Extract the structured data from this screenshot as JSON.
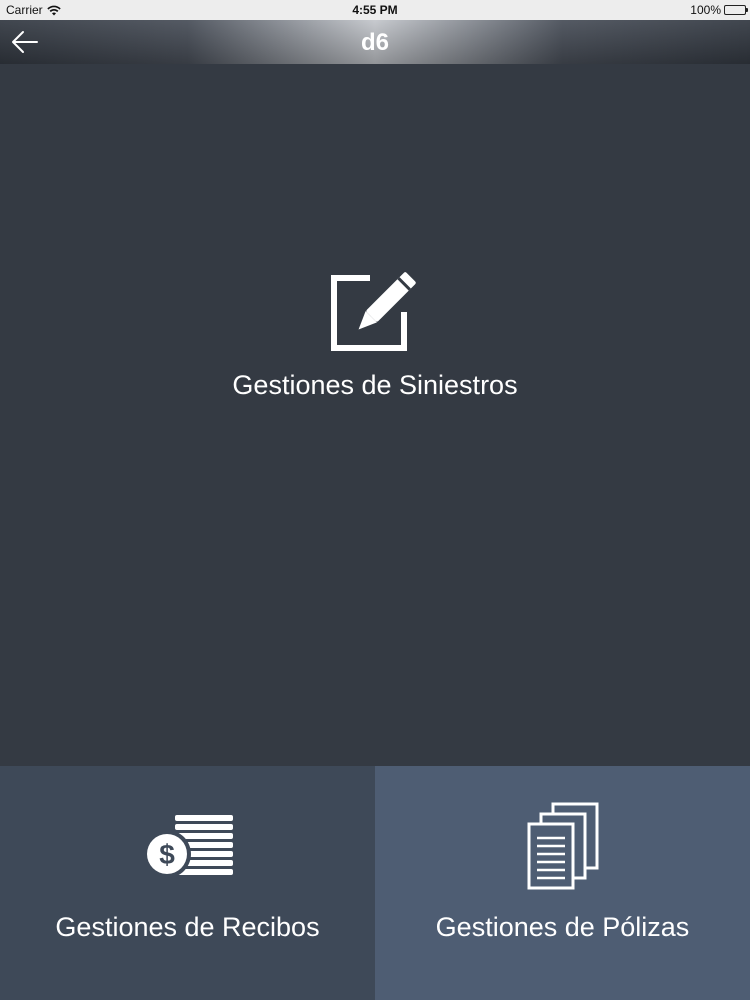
{
  "status_bar": {
    "carrier": "Carrier",
    "time": "4:55 PM",
    "battery": "100%"
  },
  "nav": {
    "back_icon": "arrow-left-icon",
    "logo_text": "d6"
  },
  "menu": {
    "siniestros": {
      "label": "Gestiones de Siniestros",
      "icon": "edit-pencil-icon"
    },
    "recibos": {
      "label": "Gestiones de Recibos",
      "icon": "coins-dollar-icon"
    },
    "polizas": {
      "label": "Gestiones de Pólizas",
      "icon": "documents-stack-icon"
    }
  },
  "colors": {
    "background": "#343a43",
    "tile_recibos": "#3e4958",
    "tile_polizas": "#4e5d73",
    "text": "#ffffff"
  }
}
